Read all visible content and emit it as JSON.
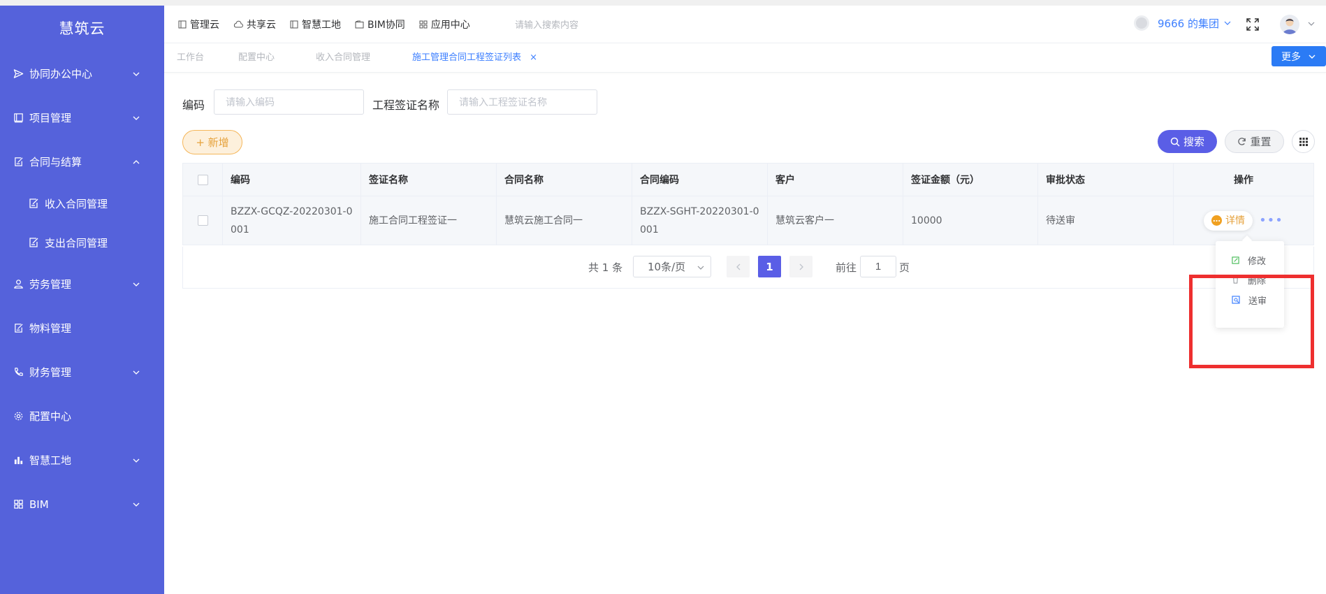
{
  "sidebar": {
    "brand": "慧筑云",
    "items": [
      {
        "label": "协同办公中心"
      },
      {
        "label": "项目管理"
      },
      {
        "label": "合同与结算"
      },
      {
        "label": "收入合同管理"
      },
      {
        "label": "支出合同管理"
      },
      {
        "label": "劳务管理"
      },
      {
        "label": "物料管理"
      },
      {
        "label": "财务管理"
      },
      {
        "label": "配置中心"
      },
      {
        "label": "智慧工地"
      },
      {
        "label": "BIM"
      }
    ]
  },
  "header": {
    "nav": [
      "管理云",
      "共享云",
      "智慧工地",
      "BIM协同",
      "应用中心"
    ],
    "search_placeholder": "请输入搜索内容",
    "org_name": "9666 的集团"
  },
  "tabs": {
    "items": [
      "工作台",
      "配置中心",
      "收入合同管理",
      "施工管理合同工程签证列表"
    ],
    "close": "×",
    "more_label": "更多"
  },
  "filter": {
    "code_label": "编码",
    "code_placeholder": "请输入编码",
    "name_label": "工程签证名称",
    "name_placeholder": "请输入工程签证名称"
  },
  "toolbar": {
    "add_label": "+ 新增",
    "search_label": "搜索",
    "reset_label": "重置"
  },
  "table": {
    "headers": [
      "编码",
      "签证名称",
      "合同名称",
      "合同编码",
      "客户",
      "签证金额（元）",
      "审批状态",
      "操作"
    ],
    "rows": [
      {
        "code": "BZZX-GCQZ-20220301-0001",
        "visa_name": "施工合同工程签证一",
        "contract_name": "慧筑云施工合同一",
        "contract_code": "BZZX-SGHT-20220301-0001",
        "customer": "慧筑云客户一",
        "amount": "10000",
        "status": "待送审",
        "action_detail": "详情",
        "action_more": "•••"
      }
    ]
  },
  "pagination": {
    "total": "共 1 条",
    "page_size": "10条/页",
    "current": "1",
    "goto_prefix": "前往",
    "goto_value": "1",
    "goto_suffix": "页"
  },
  "dropdown": {
    "items": [
      "修改",
      "删除",
      "送审"
    ]
  },
  "colors": {
    "sidebar_bg": "#5562db",
    "primary": "#5a5ee6",
    "link": "#3d7fff",
    "warning": "#e6a23c",
    "highlight_box": "#ee2f2f"
  }
}
